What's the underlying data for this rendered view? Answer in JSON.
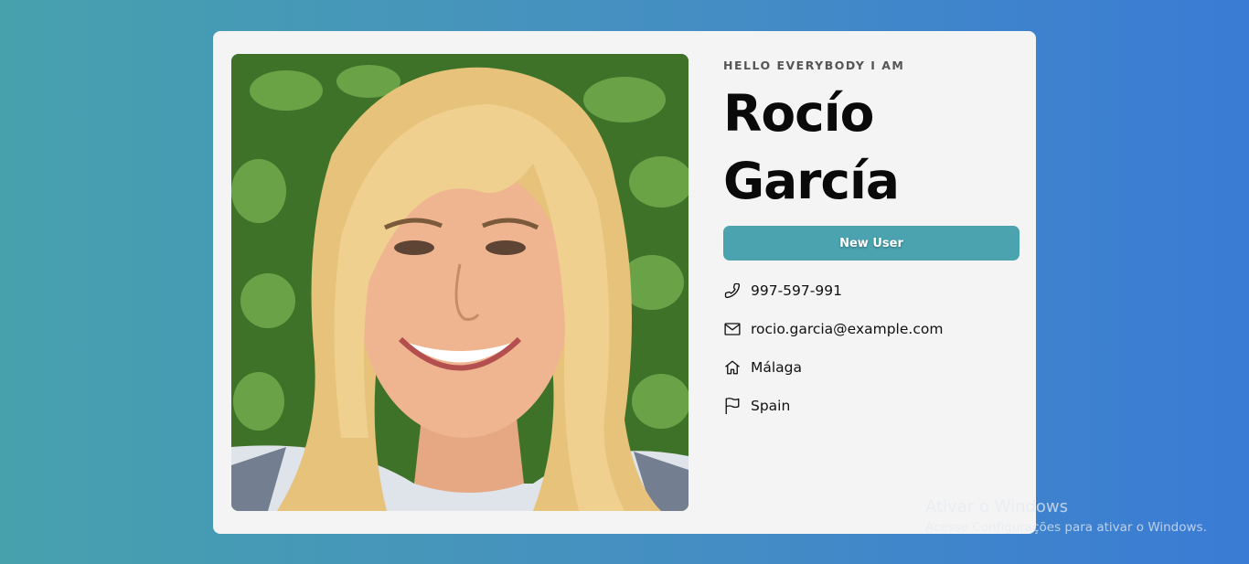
{
  "profile": {
    "greeting": "HELLO EVERYBODY I AM",
    "first_name": "Rocío",
    "last_name": "García",
    "button_label": "New User",
    "phone": "997-597-991",
    "email": "rocio.garcia@example.com",
    "city": "Málaga",
    "country": "Spain",
    "icons": {
      "phone": "phone-icon",
      "email": "envelope-icon",
      "city": "home-icon",
      "country": "flag-icon"
    }
  },
  "watermark": {
    "title": "Ativar o Windows",
    "subtitle": "Acesse Configurações para ativar o Windows."
  },
  "colors": {
    "background_start": "#47a1ad",
    "background_end": "#3a7bd5",
    "card": "#f4f4f4",
    "button": "#4aa3af"
  }
}
